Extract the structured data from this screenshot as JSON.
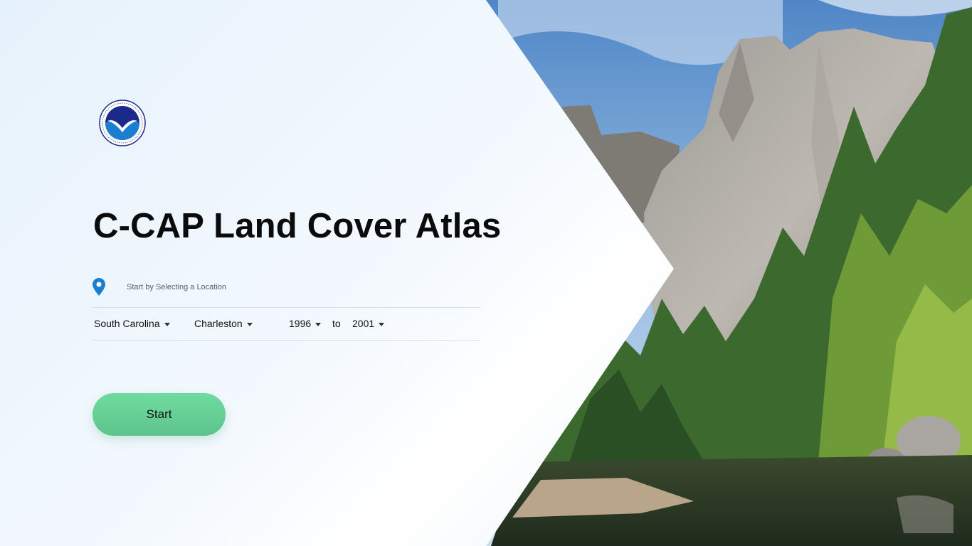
{
  "app": {
    "title": "C-CAP Land Cover Atlas",
    "logo_icon": "noaa-logo-icon"
  },
  "location": {
    "pin_icon": "location-pin-icon",
    "hint": "Start by Selecting a Location"
  },
  "filters": {
    "state": "South Carolina",
    "county": "Charleston",
    "start_year": "1996",
    "to_label": "to",
    "end_year": "2001"
  },
  "actions": {
    "start_label": "Start"
  },
  "colors": {
    "accent_green": "#62cc8f",
    "pin_blue": "#1b7fd1",
    "noaa_navy": "#1b2a8a"
  }
}
